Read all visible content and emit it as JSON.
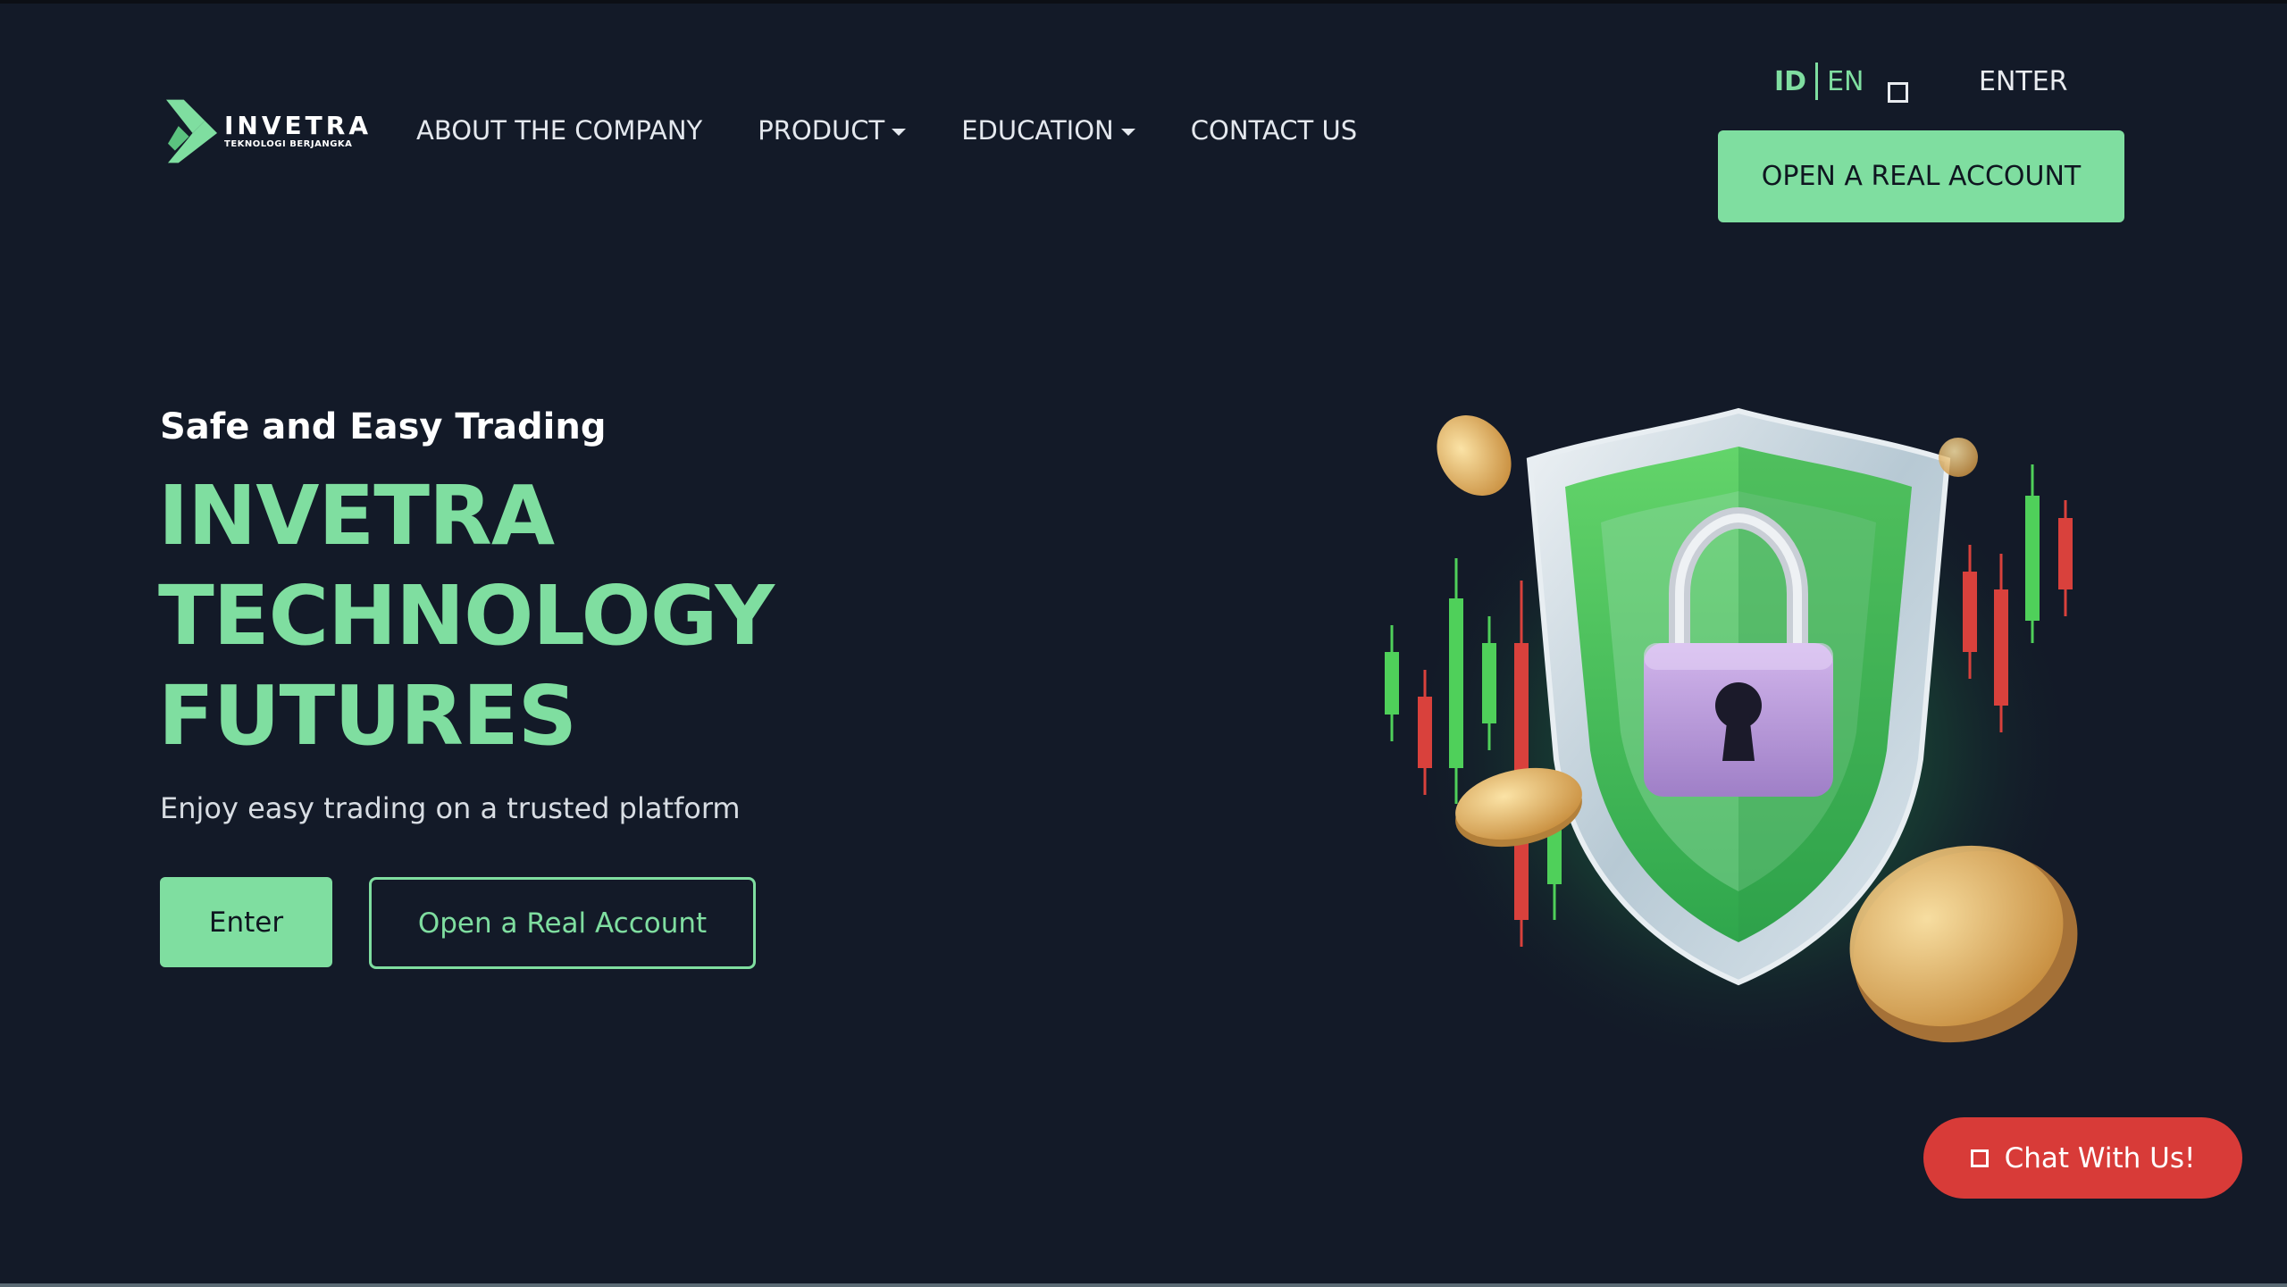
{
  "brand": {
    "name": "INVETRA",
    "tagline": "TEKNOLOGI BERJANGKA"
  },
  "nav": {
    "items": [
      {
        "label": "ABOUT THE COMPANY",
        "dropdown": false
      },
      {
        "label": "PRODUCT",
        "dropdown": true
      },
      {
        "label": "EDUCATION",
        "dropdown": true
      },
      {
        "label": "CONTACT US",
        "dropdown": false
      }
    ]
  },
  "language": {
    "options": [
      "ID",
      "EN"
    ],
    "active": "ID"
  },
  "header": {
    "enter_label": "ENTER",
    "cta_label": "OPEN A REAL ACCOUNT"
  },
  "hero": {
    "subtitle": "Safe and Easy Trading",
    "title_lines": [
      "INVETRA",
      "TECHNOLOGY",
      "FUTURES"
    ],
    "description": "Enjoy easy trading on a trusted platform",
    "primary_button": "Enter",
    "secondary_button": "Open a Real Account"
  },
  "chat": {
    "label": "Chat With Us!"
  },
  "colors": {
    "background": "#131a28",
    "accent": "#7fdea0",
    "chat": "#d83b38",
    "candle_green": "#4fd05a",
    "candle_red": "#d9413c",
    "coin": "#e9c27a",
    "lock": "#b99ad8"
  },
  "icons": {
    "logo": "chevron-logo-icon",
    "language_toggle": "square-icon",
    "chat": "square-icon",
    "illustration": "shield-lock-icon"
  }
}
